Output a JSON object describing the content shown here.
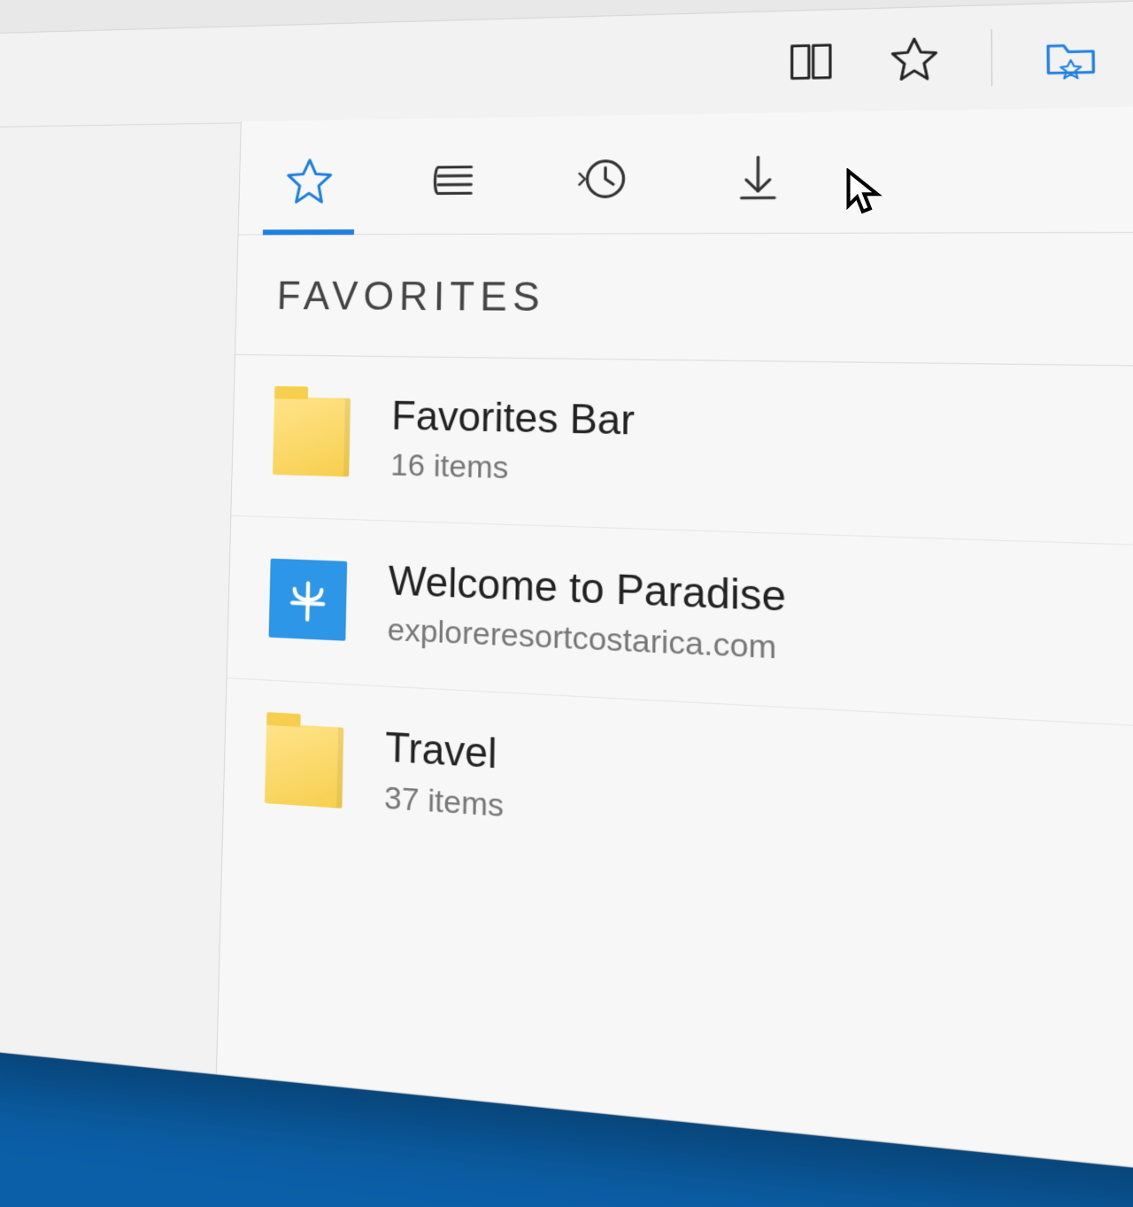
{
  "titlebar": {
    "minimize": "minimize",
    "maximize": "maximize",
    "close": "close"
  },
  "address_icons": {
    "reading_view": "reading-view",
    "favorite_star": "add-favorite",
    "hub": "hub-folder",
    "note": "web-note",
    "more": "more"
  },
  "hub": {
    "title": "FAVORITES",
    "tabs": {
      "favorites": "favorites",
      "reading_list": "reading-list",
      "history": "history",
      "downloads": "downloads"
    },
    "items": [
      {
        "type": "folder",
        "title": "Favorites Bar",
        "subtitle": "16 items"
      },
      {
        "type": "site",
        "title": "Welcome to Paradise",
        "subtitle": "exploreresortcostarica.com"
      },
      {
        "type": "folder",
        "title": "Travel",
        "subtitle": "37 items"
      }
    ]
  },
  "colors": {
    "accent": "#1e7fe0",
    "folder": "#f7cf4e",
    "site": "#2e96e6"
  }
}
